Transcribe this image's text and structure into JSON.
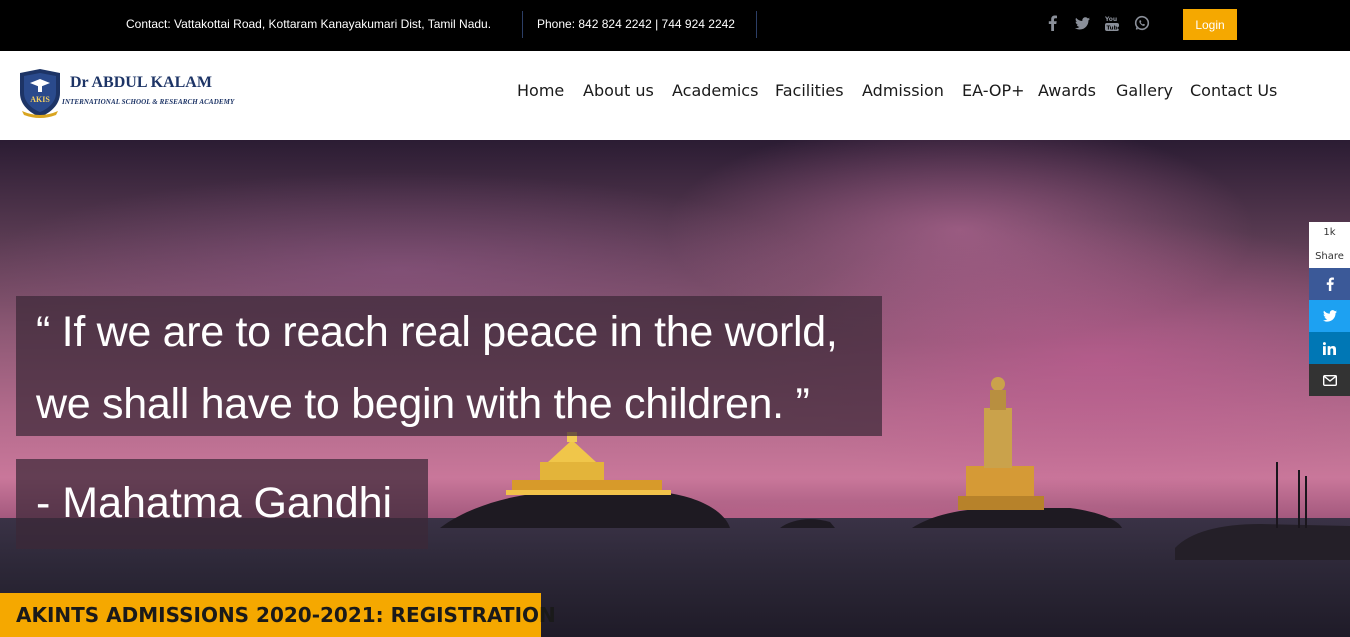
{
  "topbar": {
    "contact": "Contact: Vattakottai Road, Kottaram Kanayakumari Dist, Tamil Nadu.",
    "phone": "Phone: 842 824 2242 | 744 924 2242",
    "social": [
      "facebook-icon",
      "twitter-icon",
      "youtube-icon",
      "whatsapp-icon"
    ],
    "login_label": "Login",
    "accent": "#f5a800"
  },
  "header": {
    "logo_badge": "AKIS",
    "logo_name": "Dr ABDUL KALAM",
    "logo_subtitle": "INTERNATIONAL SCHOOL & RESEARCH ACADEMY",
    "nav": [
      "Home",
      "About us",
      "Academics",
      "Facilities",
      "Admission",
      "EA-OP+",
      "Awards",
      "Gallery",
      "Contact Us"
    ]
  },
  "hero": {
    "quote_line1": "“ If we are to reach real peace in the world,",
    "quote_line2": "we shall have to begin with the children. ”",
    "quote_author": "-  Mahatma Gandhi",
    "admission_banner": "AKINTS ADMISSIONS 2020-2021: REGISTRATION"
  },
  "share": {
    "count": "1k",
    "label": "Share",
    "buttons": [
      "facebook-icon",
      "twitter-icon",
      "linkedin-icon",
      "email-icon"
    ]
  }
}
